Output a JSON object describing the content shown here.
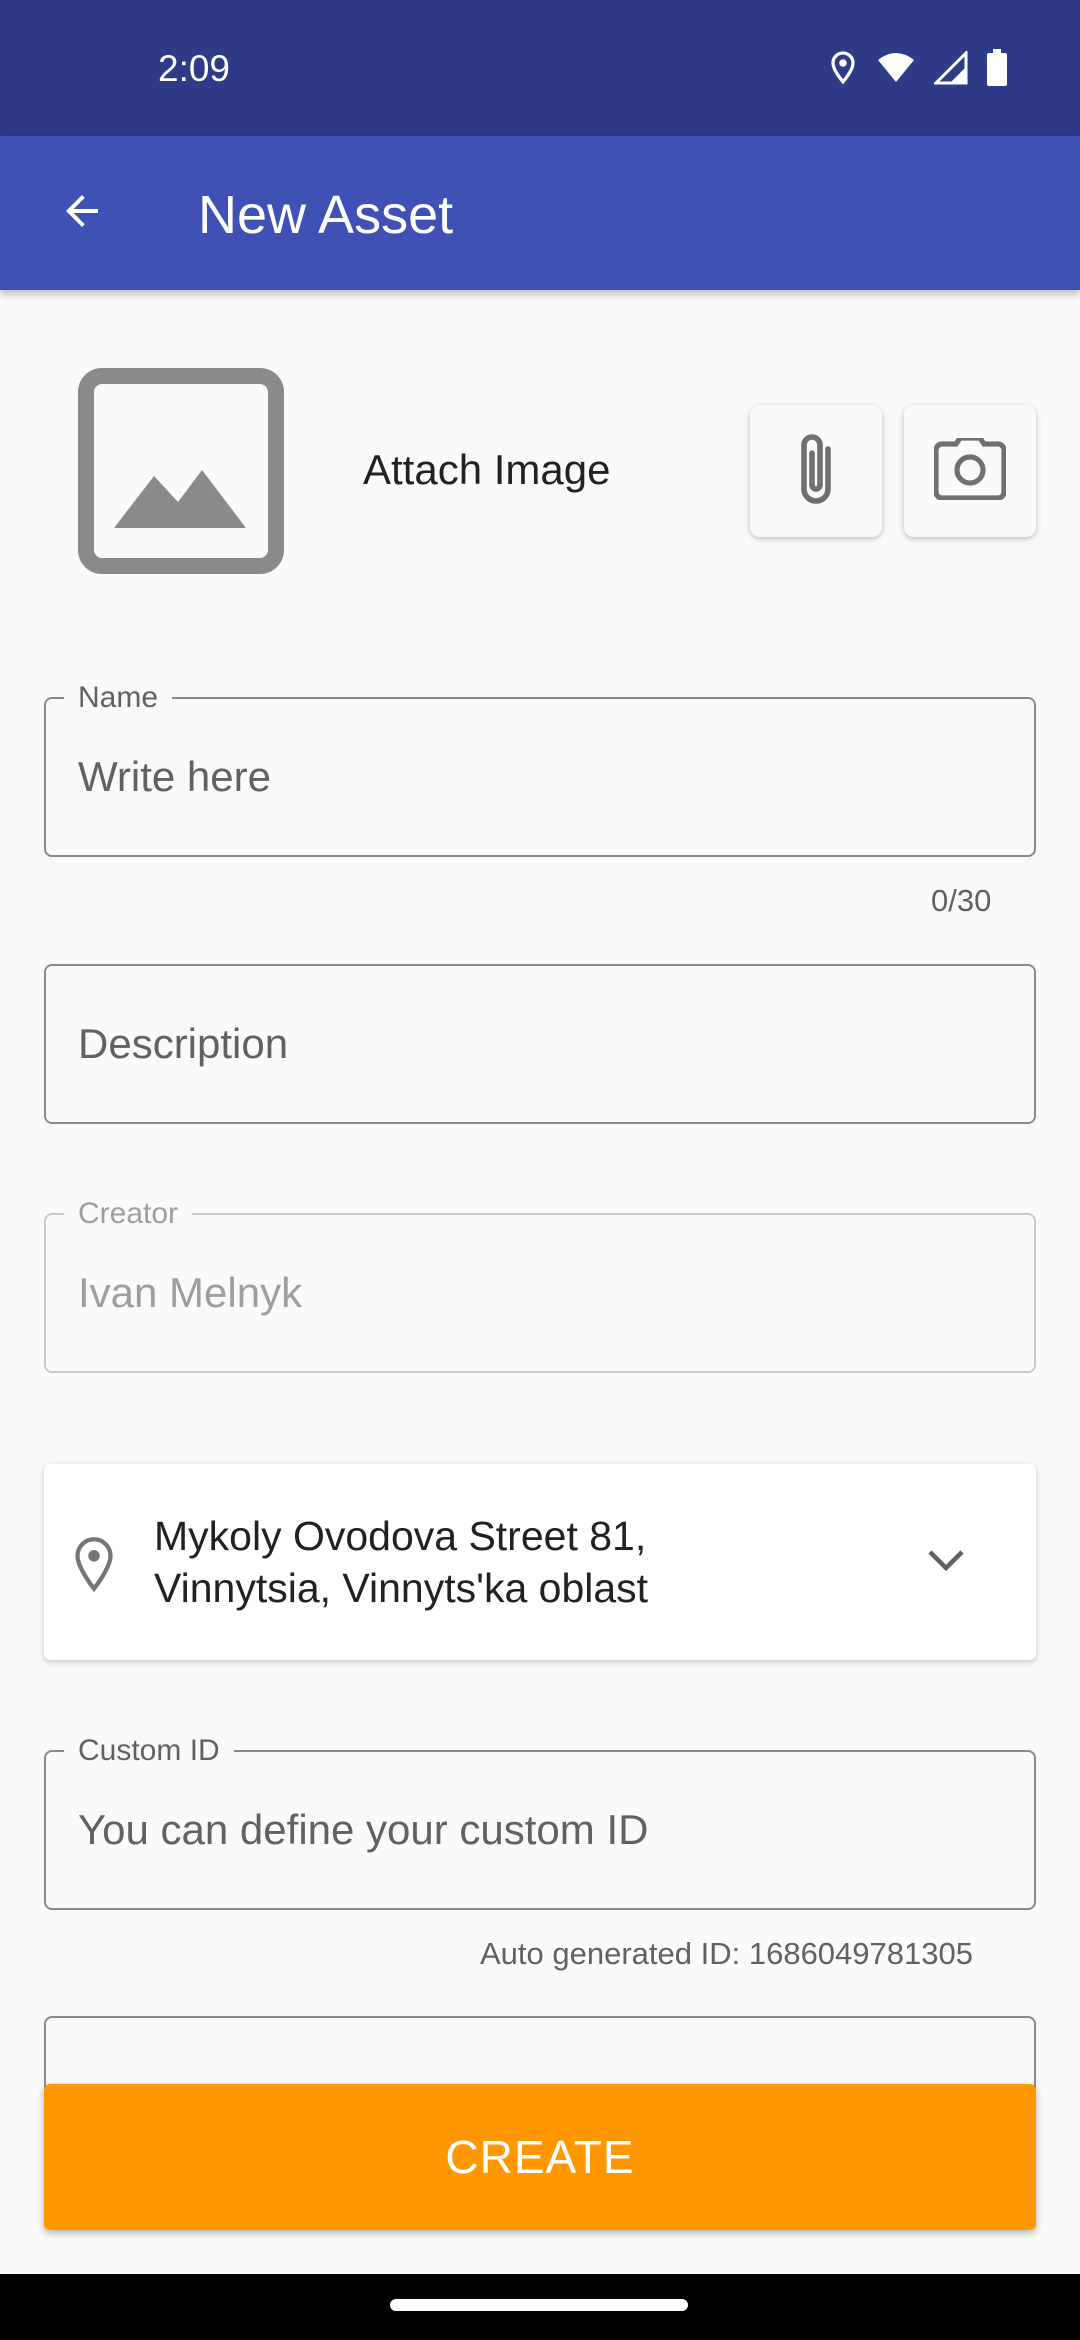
{
  "status_bar": {
    "time": "2:09",
    "icons": [
      "location-icon",
      "wifi-icon",
      "signal-icon",
      "battery-icon"
    ]
  },
  "app_bar": {
    "title": "New Asset",
    "back_icon": "arrow-back-icon"
  },
  "attachment": {
    "label": "Attach Image",
    "placeholder_icon": "image-placeholder-icon",
    "buttons": [
      "paperclip-icon",
      "camera-icon"
    ]
  },
  "form": {
    "name": {
      "label": "Name",
      "placeholder": "Write here",
      "counter": "0/30"
    },
    "description": {
      "placeholder": "Description"
    },
    "creator": {
      "label": "Creator",
      "value": "Ivan Melnyk"
    },
    "location": {
      "line1": "Mykoly Ovodova Street 81,",
      "line2": "Vinnytsia, Vinnyts'ka oblast",
      "icon": "location-pin-icon",
      "dropdown_icon": "chevron-down-icon"
    },
    "custom_id": {
      "label": "Custom ID",
      "placeholder": "You can define your custom ID",
      "helper": "Auto generated ID: 1686049781305"
    }
  },
  "actions": {
    "create_label": "CREATE"
  },
  "colors": {
    "status_bar": "#2e3b87",
    "app_bar": "#3f51b5",
    "accent": "#ff9800",
    "background": "#fafafa"
  }
}
